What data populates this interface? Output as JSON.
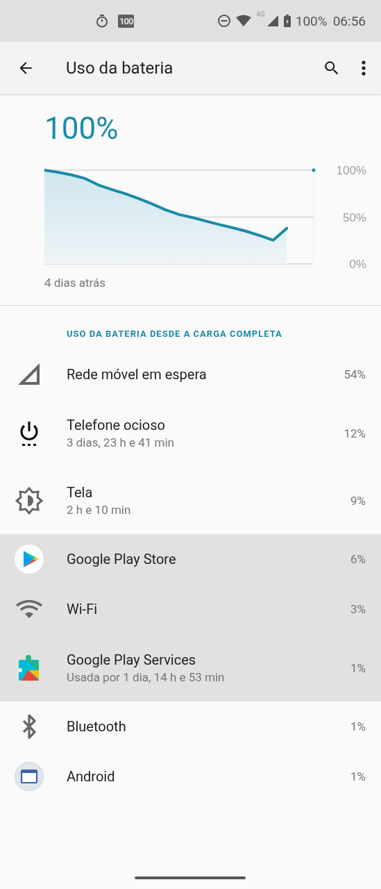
{
  "status_bar": {
    "left_icons": [
      {
        "kind": "timer"
      },
      {
        "kind": "badge",
        "text": "100"
      }
    ],
    "network_label": "4G",
    "battery": "100%",
    "time": "06:56"
  },
  "app_bar": {
    "title": "Uso da bateria"
  },
  "battery_level": "100%",
  "chart_data": {
    "type": "area",
    "ylim": [
      0,
      100
    ],
    "yticks": [
      {
        "value": 100,
        "label": "100%"
      },
      {
        "value": 50,
        "label": "50%"
      },
      {
        "value": 0,
        "label": "0%"
      }
    ],
    "xlabel": "4 dias atrás",
    "categories": [
      null,
      null,
      null,
      null,
      null,
      null,
      null,
      null,
      null,
      null,
      null,
      null,
      null,
      null,
      null,
      null,
      null,
      null,
      null,
      null,
      null
    ],
    "series": [
      {
        "color": "#1a8ba6",
        "values": [
          100,
          97.8,
          95,
          91.2,
          84.2,
          79.4,
          75,
          69.7,
          64,
          57.7,
          52.7,
          49.5,
          45.6,
          41.9,
          38.5,
          34.8,
          30.3,
          25.3,
          38,
          null,
          null
        ]
      }
    ]
  },
  "section_header": "USO DA BATERIA DESDE A CARGA COMPLETA",
  "items": [
    {
      "kind": "signal",
      "title": "Rede móvel em espera",
      "percent": "54%",
      "highlighted": false
    },
    {
      "kind": "power",
      "title": "Telefone ocioso",
      "subtitle": "3 dias, 23 h e 41 min",
      "percent": "12%",
      "highlighted": false
    },
    {
      "kind": "brightness",
      "title": "Tela",
      "subtitle": "2 h e 10 min",
      "percent": "9%",
      "highlighted": false
    },
    {
      "kind": "play-store",
      "title": "Google Play Store",
      "percent": "6%",
      "highlighted": true
    },
    {
      "kind": "wifi",
      "title": "Wi-Fi",
      "percent": "3%",
      "highlighted": true
    },
    {
      "kind": "play-services",
      "title": "Google Play Services",
      "subtitle": "Usada por 1 dia, 14 h e 53 min",
      "percent": "1%",
      "highlighted": true
    },
    {
      "kind": "bluetooth",
      "title": "Bluetooth",
      "percent": "1%",
      "highlighted": false
    },
    {
      "kind": "window",
      "title": "Android",
      "percent": "1%",
      "highlighted": false
    }
  ]
}
